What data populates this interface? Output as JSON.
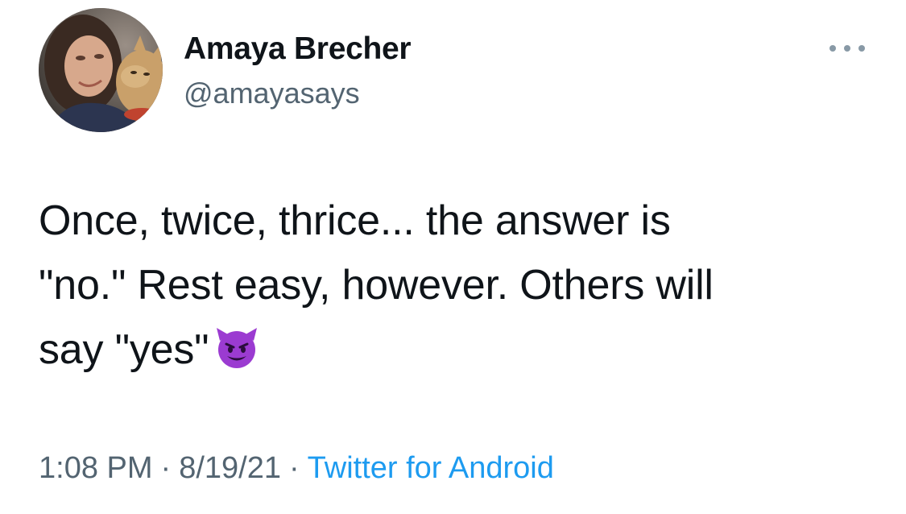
{
  "author": {
    "display_name": "Amaya Brecher",
    "handle": "@amayasays"
  },
  "tweet": {
    "line1": "Once, twice, thrice... the answer is",
    "line2": "\"no.\" Rest easy, however. Others will",
    "line3": "say \"yes\"",
    "emoji": "smiling-face-with-horns"
  },
  "meta": {
    "time": "1:08 PM",
    "separator": "·",
    "date": "8/19/21",
    "source": "Twitter for Android"
  },
  "colors": {
    "text": "#0f1419",
    "secondary": "#536471",
    "link": "#1d9bf0",
    "emoji_purple": "#9b3bd1"
  }
}
